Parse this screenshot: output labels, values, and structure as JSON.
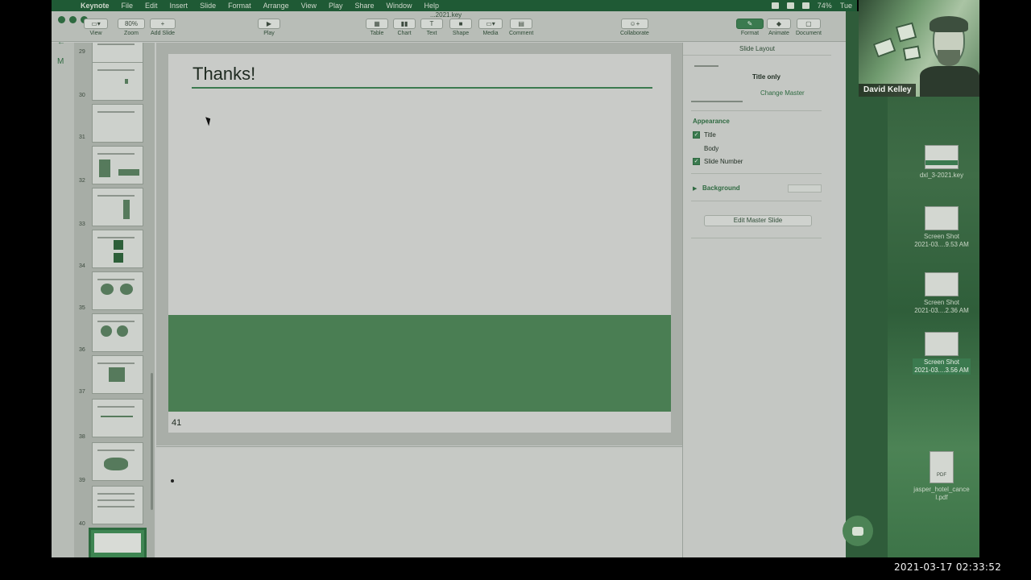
{
  "menubar": {
    "app": "Keynote",
    "items": [
      "File",
      "Edit",
      "Insert",
      "Slide",
      "Format",
      "Arrange",
      "View",
      "Play",
      "Share",
      "Window",
      "Help"
    ],
    "battery": "74%",
    "clock_partial": "Tue"
  },
  "window": {
    "document_title": "...2021.key"
  },
  "toolbar": {
    "view_label": "View",
    "zoom_value": "80%",
    "zoom_label": "Zoom",
    "add_slide_label": "Add Slide",
    "play_label": "Play",
    "table_label": "Table",
    "chart_label": "Chart",
    "text_label": "Text",
    "shape_label": "Shape",
    "media_label": "Media",
    "comment_label": "Comment",
    "collaborate_label": "Collaborate",
    "format_label": "Format",
    "animate_label": "Animate",
    "document_label": "Document"
  },
  "navigator": {
    "slides": [
      {
        "num": "29"
      },
      {
        "num": "30"
      },
      {
        "num": "31"
      },
      {
        "num": "32"
      },
      {
        "num": "33"
      },
      {
        "num": "34"
      },
      {
        "num": "35"
      },
      {
        "num": "36"
      },
      {
        "num": "37"
      },
      {
        "num": "38"
      },
      {
        "num": "39"
      },
      {
        "num": "40"
      },
      {
        "num": "41"
      }
    ]
  },
  "slide": {
    "title": "Thanks!",
    "number": "41"
  },
  "inspector": {
    "header": "Slide Layout",
    "layout_name": "Title only",
    "change_master": "Change Master",
    "appearance_label": "Appearance",
    "title_label": "Title",
    "body_label": "Body",
    "slide_number_label": "Slide Number",
    "background_label": "Background",
    "edit_master": "Edit Master Slide"
  },
  "desktop": {
    "icons": [
      {
        "label": "dxl_3-2021.key"
      },
      {
        "label": "Screen Shot\n2021-03....9.53 AM"
      },
      {
        "label": "Screen Shot\n2021-03....2.36 AM"
      },
      {
        "label": "Screen Shot\n2021-03....3.56 AM"
      },
      {
        "label": "jasper_hotel_cance\nl.pdf",
        "tag": "PDF"
      }
    ]
  },
  "webcam": {
    "participant_name": "David Kelley"
  },
  "recording": {
    "timestamp": "2021-03-17  02:33:52"
  },
  "colors": {
    "accent": "#3b7a4f",
    "band": "#4a7e53",
    "menubar": "#1f5a35"
  }
}
